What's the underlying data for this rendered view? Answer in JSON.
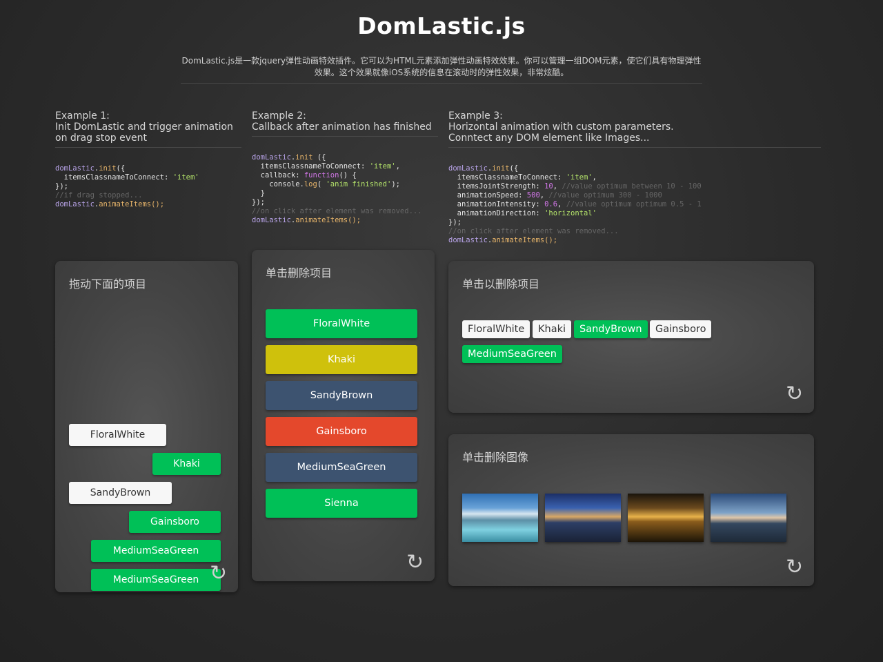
{
  "header": {
    "title": "DomLastic.js",
    "description_line1": "DomLastic.js是一款jquery弹性动画特效插件。它可以为HTML元素添加弹性动画特效效果。你可以管理一组DOM元素，使它们具有物理弹性",
    "description_line2": "效果。这个效果就像iOS系统的信息在滚动时的弹性效果，非常炫酷。"
  },
  "examples": [
    {
      "heading_line1": "Example 1:",
      "heading_line2": "Init DomLastic and trigger animation",
      "heading_line3": "on drag stop event",
      "panel_title": "拖动下面的项目",
      "items": [
        "FloralWhite",
        "Khaki",
        "SandyBrown",
        "Gainsboro",
        "MediumSeaGreen",
        "MediumSeaGreen"
      ]
    },
    {
      "heading_line1": "Example 2:",
      "heading_line2": "Callback after animation has finished",
      "panel_title": "单击删除项目",
      "items": [
        "FloralWhite",
        "Khaki",
        "SandyBrown",
        "Gainsboro",
        "MediumSeaGreen",
        "Sienna"
      ],
      "item_colors": [
        "#00c057",
        "#cfc10c",
        "#3d5370",
        "#e4482c",
        "#3d5370",
        "#00c057"
      ]
    },
    {
      "heading_line1": "Example 3:",
      "heading_line2": "Horizontal animation with custom parameters.",
      "heading_line3": "Conntect any DOM element like Images...",
      "panel_title": "单击以删除项目",
      "items": [
        "FloralWhite",
        "Khaki",
        "SandyBrown",
        "Gainsboro",
        "MediumSeaGreen"
      ],
      "image_panel_title": "单击删除图像"
    }
  ],
  "reload_icon": "↻",
  "colors": {
    "green": "#00c057",
    "white_item": "#f7f7f7",
    "khaki": "#cfc10c",
    "slate": "#3d5370",
    "red": "#e4482c"
  }
}
